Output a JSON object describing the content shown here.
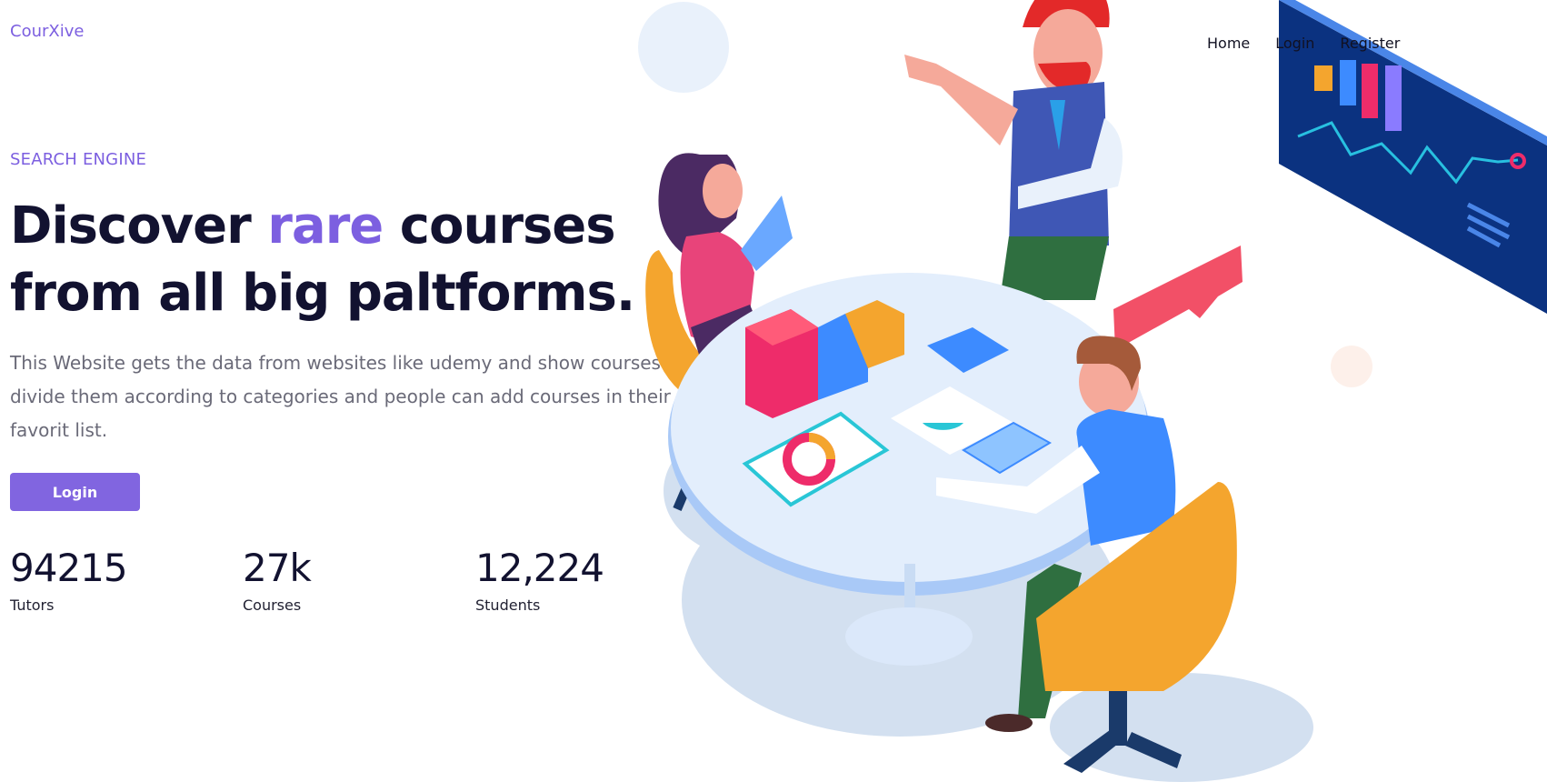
{
  "brand": {
    "name": "CourXive"
  },
  "nav": {
    "items": [
      {
        "label": "Home"
      },
      {
        "label": "Login"
      },
      {
        "label": "Register"
      }
    ]
  },
  "hero": {
    "eyebrow": "SEARCH ENGINE",
    "headline_before": "Discover ",
    "headline_accent": "rare",
    "headline_after": " courses from all big paltforms.",
    "description": "This Website gets the data from websites like udemy and show courses and divide them according to categories and people can add courses in their favorit list.",
    "cta_label": "Login"
  },
  "stats": [
    {
      "value": "94215",
      "label": "Tutors"
    },
    {
      "value": "27k",
      "label": "Courses"
    },
    {
      "value": "12,224",
      "label": "Students"
    }
  ],
  "colors": {
    "accent": "#7c5fe0",
    "button": "#8165e0",
    "heading": "#121230",
    "body_text": "#6a6a78"
  },
  "illustration": {
    "icon": "team-meeting-illustration"
  }
}
